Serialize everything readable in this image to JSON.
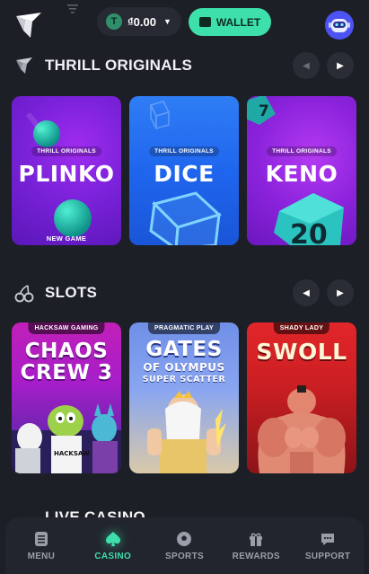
{
  "header": {
    "balance": "₫0.00",
    "wallet_label": "WALLET"
  },
  "sections": {
    "originals": {
      "title": "THRILL ORIGINALS"
    },
    "slots": {
      "title": "SLOTS"
    },
    "live": {
      "title": "LIVE CASINO"
    }
  },
  "originals": [
    {
      "tag": "THRILL ORIGINALS",
      "name": "PLINKO",
      "badge": "NEW GAME"
    },
    {
      "tag": "THRILL ORIGINALS",
      "name": "DICE"
    },
    {
      "tag": "THRILL ORIGINALS",
      "name": "KENO",
      "dice_a": "7",
      "dice_b": "20"
    }
  ],
  "slots": [
    {
      "provider": "HACKSAW GAMING",
      "line1": "CHAOS",
      "line2": "CREW 3",
      "shirt": "HACKSAW"
    },
    {
      "provider": "PRAGMATIC PLAY",
      "line1": "GATES",
      "line2": "OF OLYMPUS",
      "line3": "SUPER SCATTER"
    },
    {
      "provider": "SHADY LADY",
      "line1": "SWOLL"
    }
  ],
  "nav": [
    {
      "label": "MENU",
      "icon": "menu-icon"
    },
    {
      "label": "CASINO",
      "icon": "casino-icon",
      "active": true
    },
    {
      "label": "SPORTS",
      "icon": "sports-icon"
    },
    {
      "label": "REWARDS",
      "icon": "rewards-icon"
    },
    {
      "label": "SUPPORT",
      "icon": "support-icon"
    }
  ],
  "colors": {
    "background": "#1d1f27",
    "accent": "#3de0ab",
    "panel": "#272a33"
  }
}
